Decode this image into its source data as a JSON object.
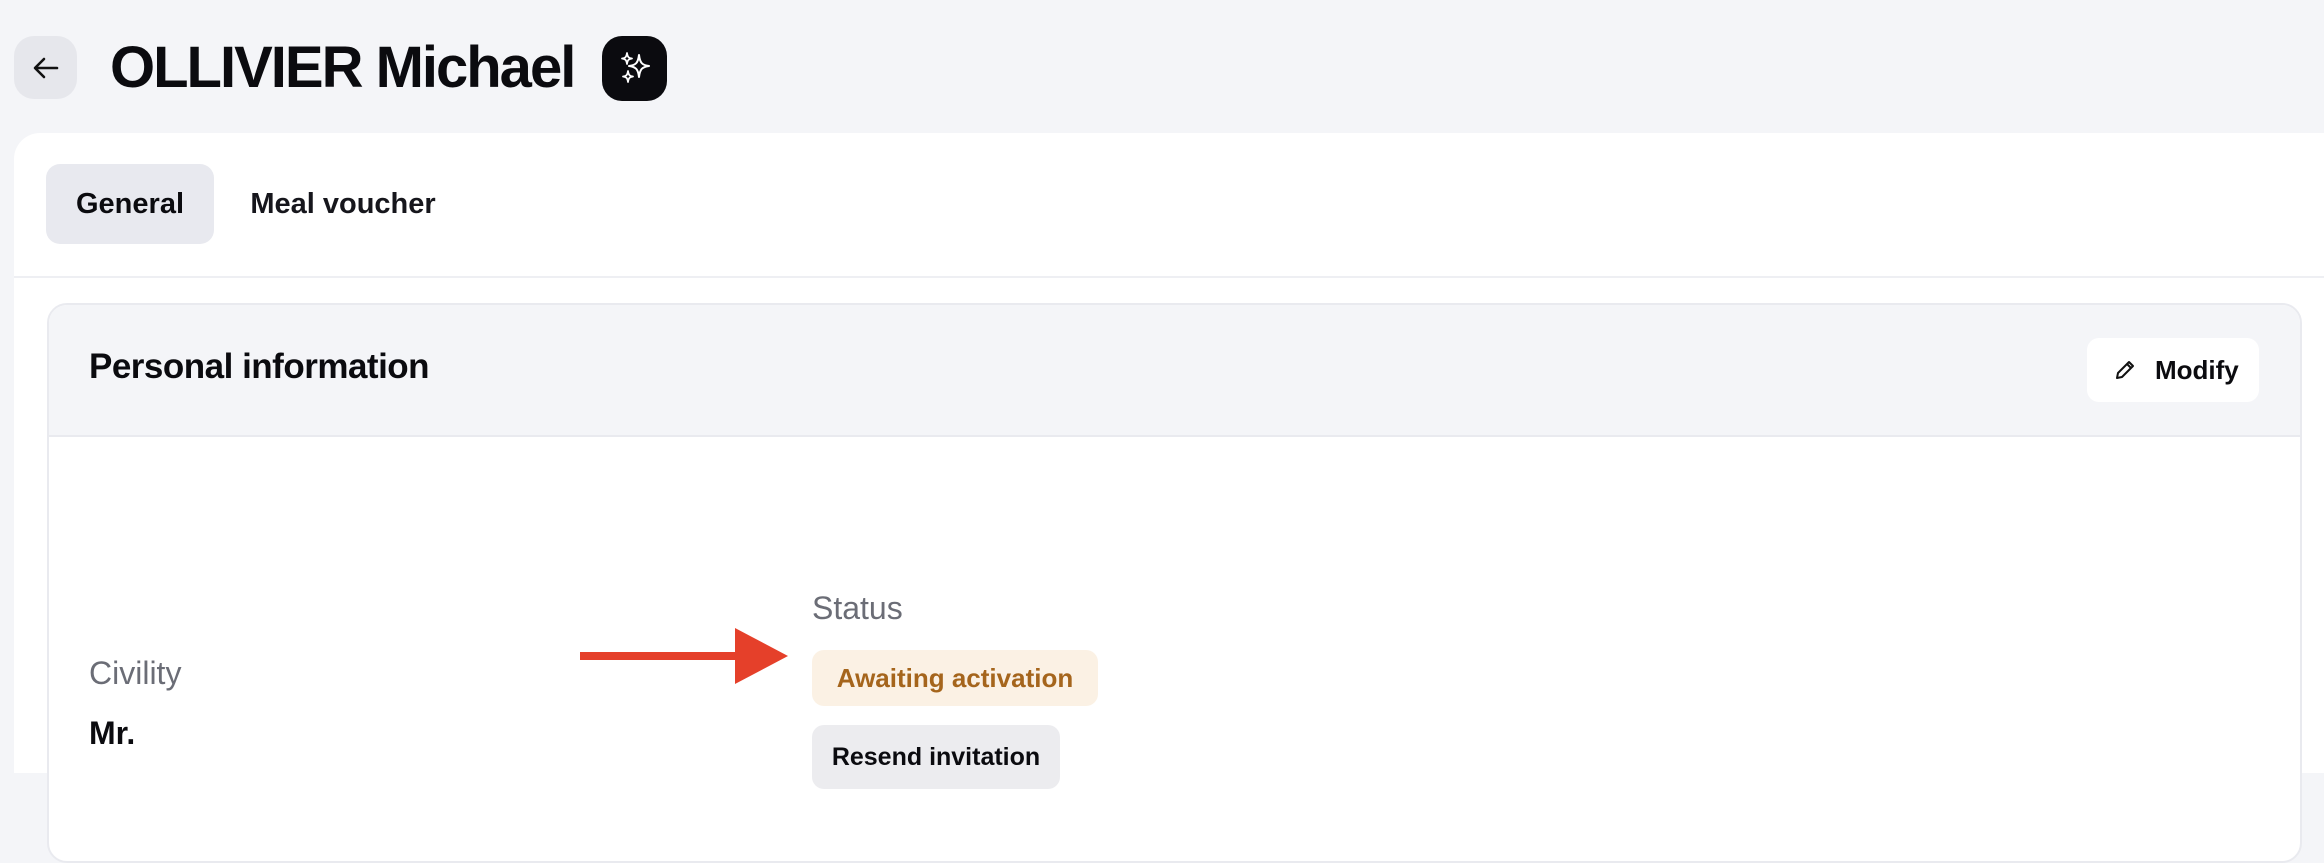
{
  "header": {
    "back_icon": "arrow-left-icon",
    "title": "OLLIVIER Michael",
    "ai_icon": "sparkles-icon"
  },
  "tabs": [
    {
      "label": "General",
      "active": true
    },
    {
      "label": "Meal voucher",
      "active": false
    }
  ],
  "personal_information": {
    "title": "Personal information",
    "modify_label": "Modify",
    "modify_icon": "pencil-icon",
    "civility": {
      "label": "Civility",
      "value": "Mr."
    },
    "status": {
      "label": "Status",
      "badge": "Awaiting activation",
      "badge_color": "#a5651c",
      "badge_background": "#fbf1e4"
    },
    "resend_label": "Resend invitation"
  },
  "annotation": {
    "icon": "red-arrow-icon",
    "color": "#e5402a"
  }
}
